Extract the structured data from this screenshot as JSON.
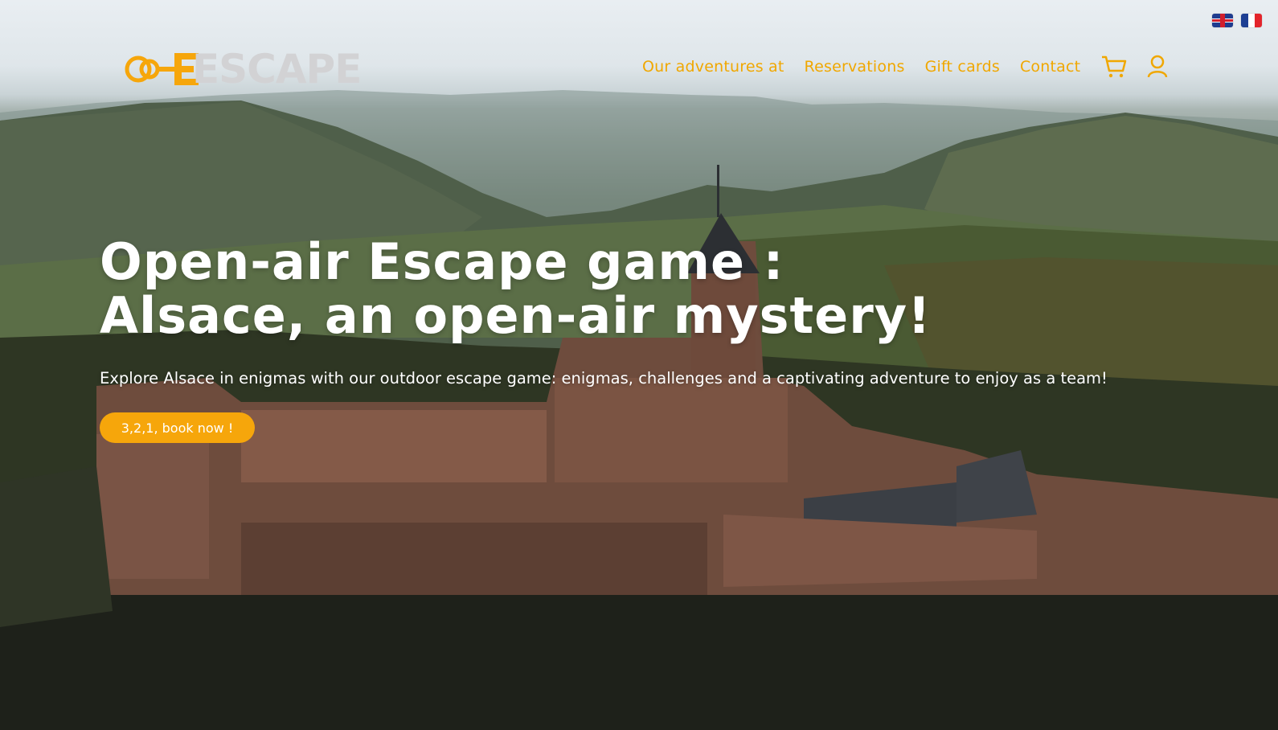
{
  "header": {
    "logo_text": "ESCAPE",
    "languages": [
      {
        "code": "en",
        "icon": "uk-flag-icon"
      },
      {
        "code": "fr",
        "icon": "france-flag-icon"
      }
    ],
    "nav": [
      {
        "label": "Our adventures at"
      },
      {
        "label": "Reservations"
      },
      {
        "label": "Gift cards"
      },
      {
        "label": "Contact"
      }
    ],
    "cart_icon": "shopping-cart-icon",
    "account_icon": "user-icon"
  },
  "hero": {
    "title_line1": "Open-air Escape game :",
    "title_line2": "Alsace, an open-air mystery!",
    "subtitle": "Explore Alsace in enigmas with our outdoor escape game: enigmas, challenges and a captivating adventure to enjoy as a team!",
    "cta_label": "3,2,1, book now !"
  },
  "colors": {
    "accent": "#f6a60b",
    "nav_text": "#f0a700",
    "logo_grey": "#d2d2d4",
    "headline": "#ffffff"
  }
}
